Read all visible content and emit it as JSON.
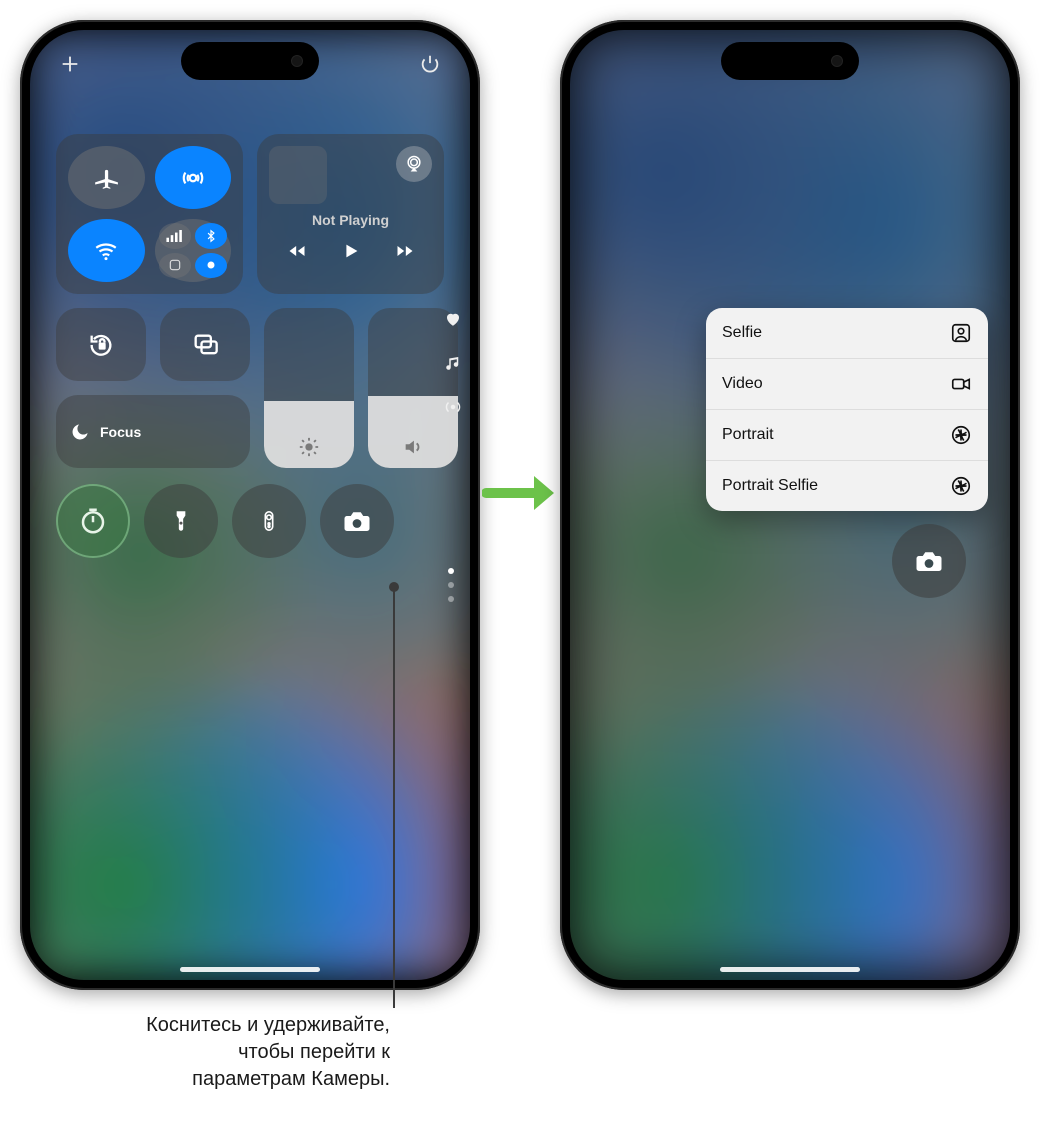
{
  "media": {
    "status": "Not Playing"
  },
  "focus": {
    "label": "Focus"
  },
  "sliders": {
    "brightness_pct": 42,
    "volume_pct": 45
  },
  "sideIcons": [
    "heart-icon",
    "music-icon",
    "hotspot-icon"
  ],
  "pageDots": {
    "count": 3,
    "active": 0
  },
  "camera_menu": {
    "items": [
      {
        "label": "Selfie",
        "icon": "person-square-icon"
      },
      {
        "label": "Video",
        "icon": "video-icon"
      },
      {
        "label": "Portrait",
        "icon": "aperture-icon"
      },
      {
        "label": "Portrait Selfie",
        "icon": "aperture-icon"
      }
    ]
  },
  "callout": {
    "line1": "Коснитесь и удерживайте,",
    "line2": "чтобы перейти к",
    "line3": "параметрам Камеры."
  }
}
